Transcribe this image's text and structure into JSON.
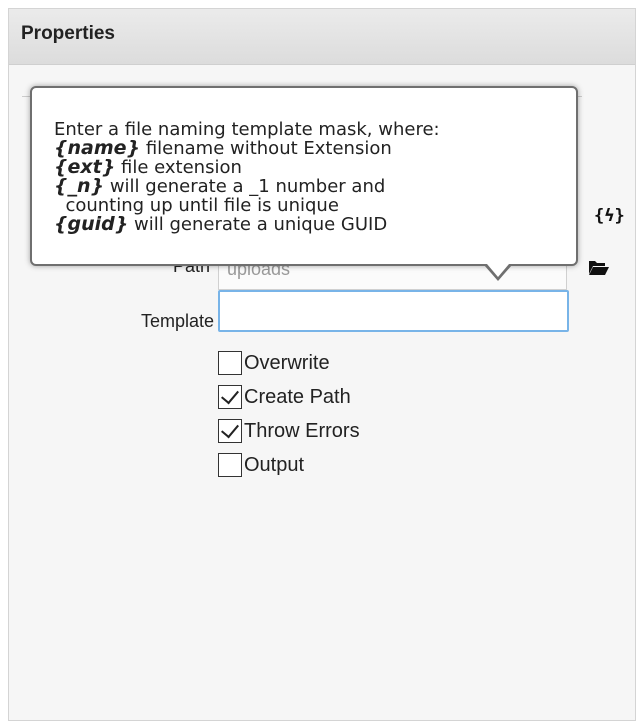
{
  "panel": {
    "title": "Properties"
  },
  "icons": {
    "variable": "{ϟ}",
    "folder": "folder-open"
  },
  "fields": {
    "path": {
      "label": "Path",
      "value": "uploads"
    },
    "template": {
      "label": "Template",
      "value": ""
    }
  },
  "checkboxes": [
    {
      "label": "Overwrite",
      "checked": false
    },
    {
      "label": "Create Path",
      "checked": true
    },
    {
      "label": "Throw Errors",
      "checked": true
    },
    {
      "label": "Output",
      "checked": false
    }
  ],
  "tooltip": {
    "intro": "Enter a file naming template mask, where:",
    "lines": [
      {
        "token": "{name}",
        "text": " filename without Extension"
      },
      {
        "token": "{ext}",
        "text": " file extension"
      },
      {
        "token": "{_n}",
        "text": " will generate a _1 number and"
      },
      {
        "token": "",
        "text": "  counting up until file is unique"
      },
      {
        "token": "{guid}",
        "text": " will generate a unique GUID"
      }
    ]
  }
}
